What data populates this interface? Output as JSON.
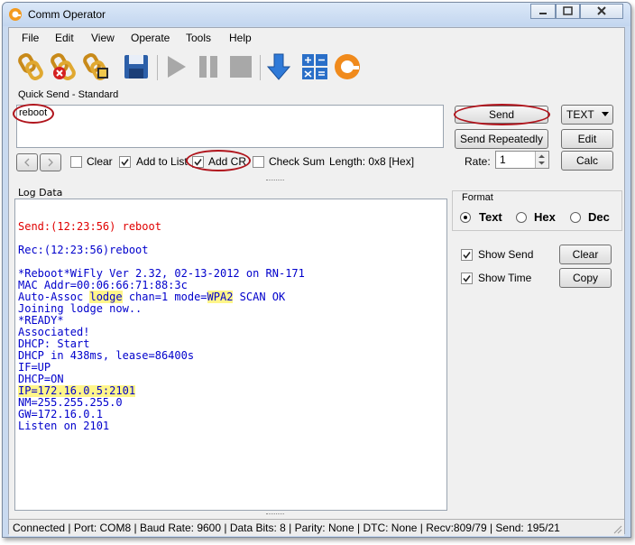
{
  "window": {
    "title": "Comm Operator"
  },
  "menu": [
    "File",
    "Edit",
    "View",
    "Operate",
    "Tools",
    "Help"
  ],
  "toolbar": {
    "icons": [
      "connect-icon",
      "disconnect-icon",
      "settings-icon",
      "save-icon",
      "play-icon",
      "pause-icon",
      "stop-icon",
      "download-icon",
      "calculator-icon",
      "app-logo-icon"
    ]
  },
  "quick_send": {
    "title": "Quick Send - Standard",
    "text": "reboot",
    "clear_label": "Clear",
    "add_to_list_label": "Add to List",
    "add_cr_label": "Add CR",
    "checksum_label": "Check Sum",
    "length": "Length: 0x8 [Hex]",
    "send_label": "Send",
    "send_repeatedly_label": "Send Repeatedly",
    "mode": "TEXT",
    "edit_label": "Edit",
    "rate_label": "Rate:",
    "rate_value": "1",
    "calc_label": "Calc",
    "clear_checked": false,
    "add_to_list_checked": true,
    "add_cr_checked": true,
    "checksum_checked": false
  },
  "log": {
    "title": "Log Data",
    "send_line": "Send:(12:23:56) reboot",
    "rec_line": "Rec:(12:23:56)reboot",
    "l1": "*Reboot*WiFly Ver 2.32, 02-13-2012 on RN-171",
    "l2": "MAC Addr=00:06:66:71:88:3c",
    "l3a": "Auto-Assoc ",
    "l3b": "lodge",
    "l3c": " chan=1 mode=",
    "l3d": "WPA2",
    "l3e": " SCAN OK",
    "l4": "Joining lodge now..",
    "l5": "*READY*",
    "l6": "Associated!",
    "l7": "DHCP: Start",
    "l8": "DHCP in 438ms, lease=86400s",
    "l9": "IF=UP",
    "l10": "DHCP=ON",
    "l11": "IP=172.16.0.5:2101",
    "l12": "NM=255.255.255.0",
    "l13": "GW=172.16.0.1",
    "l14": "Listen on 2101"
  },
  "format": {
    "title": "Format",
    "options": [
      "Text",
      "Hex",
      "Dec"
    ],
    "selected": "Text",
    "show_send_label": "Show Send",
    "show_time_label": "Show Time",
    "clear_label": "Clear",
    "copy_label": "Copy",
    "show_send_checked": true,
    "show_time_checked": true
  },
  "status": "Connected | Port: COM8 | Baud Rate: 9600 | Data Bits: 8 | Parity: None | DTC: None | Recv:809/79 | Send: 195/21",
  "colors": {
    "send_text": "#e00000",
    "log_text": "#0000cc",
    "highlight": "#fff58a",
    "annotation": "#b0141c"
  }
}
